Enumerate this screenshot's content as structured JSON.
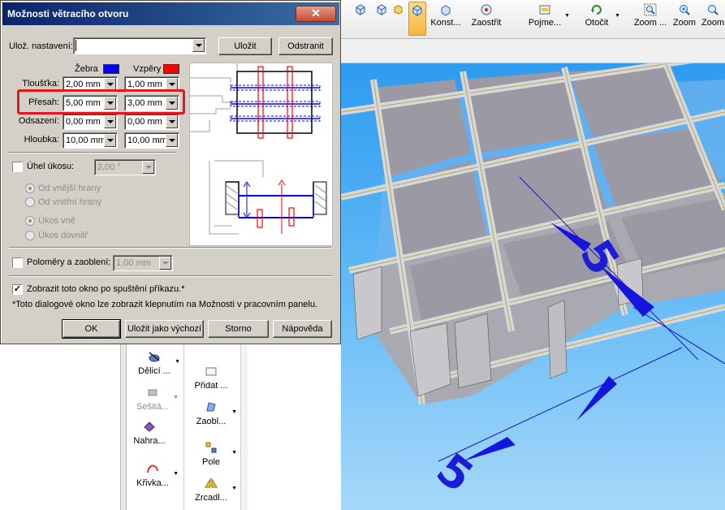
{
  "toolbar": {
    "items": [
      {
        "label": "",
        "icon": "view-cube-icon"
      },
      {
        "label": "",
        "icon": "view-cube-icon"
      },
      {
        "label": "",
        "icon": "view-cube-icon"
      },
      {
        "label": "",
        "icon": "view-cube-active-icon"
      },
      {
        "label": "Konst...",
        "icon": "construction-icon"
      },
      {
        "label": "Zaostřit",
        "icon": "focus-icon"
      },
      {
        "label": "Pojme...",
        "icon": "name-view-icon"
      },
      {
        "label": "Otočit",
        "icon": "rotate-icon"
      },
      {
        "label": "Zoom ...",
        "icon": "zoom-window-icon"
      },
      {
        "label": "Zoom",
        "icon": "zoom-icon"
      },
      {
        "label": "Zoom",
        "icon": "zoom-fit-icon"
      }
    ]
  },
  "dialog": {
    "title": "Možnosti větracího otvoru",
    "close_label": "✕",
    "saved_settings_label": "Ulož. nastavení:",
    "saved_settings_value": "",
    "save_button": "Uložit",
    "remove_button": "Odstranit",
    "col_ribs": "Žebra",
    "col_struts": "Vzpěry",
    "ribs_color": "#0000ff",
    "struts_color": "#ff0000",
    "rows": [
      {
        "label": "Tloušťka:",
        "ribs": "2,00 mm",
        "struts": "1,00 mm"
      },
      {
        "label": "Přesah:",
        "ribs": "5,00 mm",
        "struts": "3,00 mm"
      },
      {
        "label": "Odsazení:",
        "ribs": "0,00 mm",
        "struts": "0,00 mm"
      },
      {
        "label": "Hloubka:",
        "ribs": "10,00 mm",
        "struts": "10,00 mm"
      }
    ],
    "draft_angle_label": "Úhel úkosu:",
    "draft_angle_value": "2,00 °",
    "draft_from_outer": "Od vnější hrany",
    "draft_from_inner": "Od vnitřní hrany",
    "draft_out": "Úkos vně",
    "draft_in": "Úkos dovnitř",
    "radii_label": "Poloměry a zaoblení:",
    "radii_value": "1,00 mm",
    "show_on_start_label": "Zobrazit toto okno po spuštění příkazu.*",
    "show_on_start_checked": "✓",
    "footnote": "*Toto dialogové okno lze zobrazit klepnutím na Možnosti v pracovním panelu.",
    "buttons": {
      "ok": "OK",
      "save_default": "Uložit jako výchozí",
      "cancel": "Storno",
      "help": "Nápověda"
    }
  },
  "panel": {
    "tools": [
      {
        "label": "Dělicí ...",
        "icon": "split-icon",
        "dimmed": false
      },
      {
        "label": "Sešitá...",
        "icon": "stitch-icon",
        "dimmed": true
      },
      {
        "label": "Nahra...",
        "icon": "replace-icon",
        "dimmed": false
      },
      {
        "label": "Křivka...",
        "icon": "curve-icon",
        "dimmed": false
      },
      {
        "label": "Přidat ...",
        "icon": "add-icon",
        "dimmed": false
      },
      {
        "label": "Zaobl...",
        "icon": "fillet-icon",
        "dimmed": false
      },
      {
        "label": "Pole",
        "icon": "pattern-icon",
        "dimmed": false
      },
      {
        "label": "Zrcadl...",
        "icon": "mirror-icon",
        "dimmed": false
      }
    ]
  },
  "viewport": {
    "dimension_near": "5",
    "dimension_far": "5"
  }
}
